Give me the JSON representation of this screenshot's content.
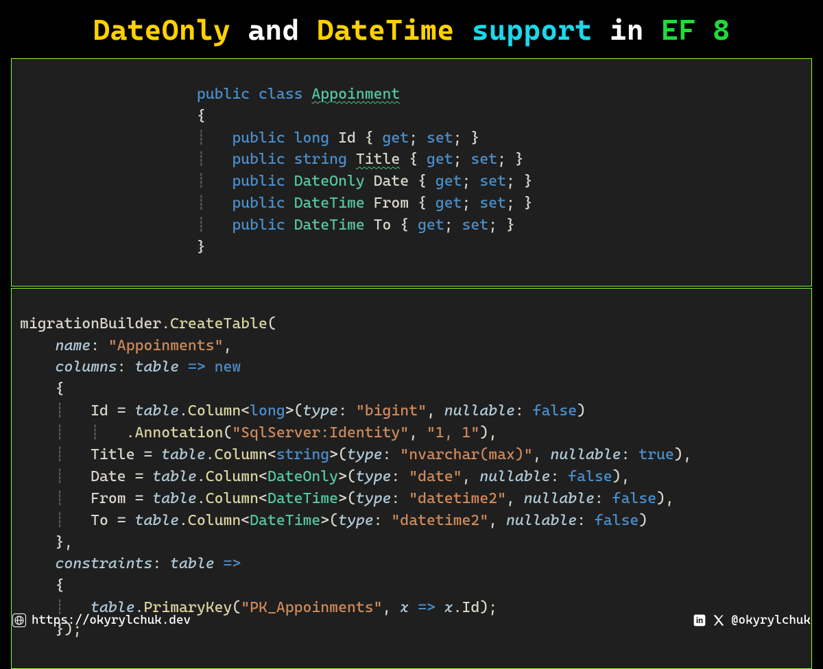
{
  "title": {
    "p1": "DateOnly",
    "p2": " and ",
    "p3": "DateTime",
    "p4": " support",
    "p5": " in ",
    "p6": "EF 8"
  },
  "code1": {
    "l1_a": "public",
    "l1_b": "class",
    "l1_c": "Appoinment",
    "brace_o": "{",
    "brace_c": "}",
    "prop": {
      "pub": "public",
      "long": "long",
      "string": "string",
      "dateonly": "DateOnly",
      "datetime": "DateTime",
      "id": "Id",
      "title": "Title",
      "date": "Date",
      "from": "From",
      "to": "To",
      "get": "get",
      "set": "set"
    }
  },
  "code2": {
    "mb": "migrationBuilder",
    "dot": ".",
    "ct": "CreateTable",
    "open": "(",
    "name_k": "name",
    "name_v": "\"Appoinments\"",
    "cols_k": "columns",
    "tbl": "table",
    "arrow": "=>",
    "new": "new",
    "col": "Column",
    "ann": "Annotation",
    "id": "Id",
    "title": "Title",
    "date": "Date",
    "from": "From",
    "to": "To",
    "long": "long",
    "string": "string",
    "dateonly": "DateOnly",
    "datetime": "DateTime",
    "type_k": "type",
    "null_k": "nullable",
    "bigint": "\"bigint\"",
    "nvarchar": "\"nvarchar(max)\"",
    "datesql": "\"date\"",
    "dt2": "\"datetime2\"",
    "sqlid": "\"SqlServer:Identity\"",
    "one": "\"1, 1\"",
    "false": "false",
    "true": "true",
    "cons_k": "constraints",
    "pk": "PrimaryKey",
    "pkname": "\"PK_Appoinments\"",
    "x": "x",
    "idp": "Id",
    "brace_o": "{",
    "brace_c": "}",
    "comma": ",",
    "close": ");"
  },
  "footer": {
    "url": "https://okyrylchuk.dev",
    "handle": "@okyrylchuk"
  }
}
